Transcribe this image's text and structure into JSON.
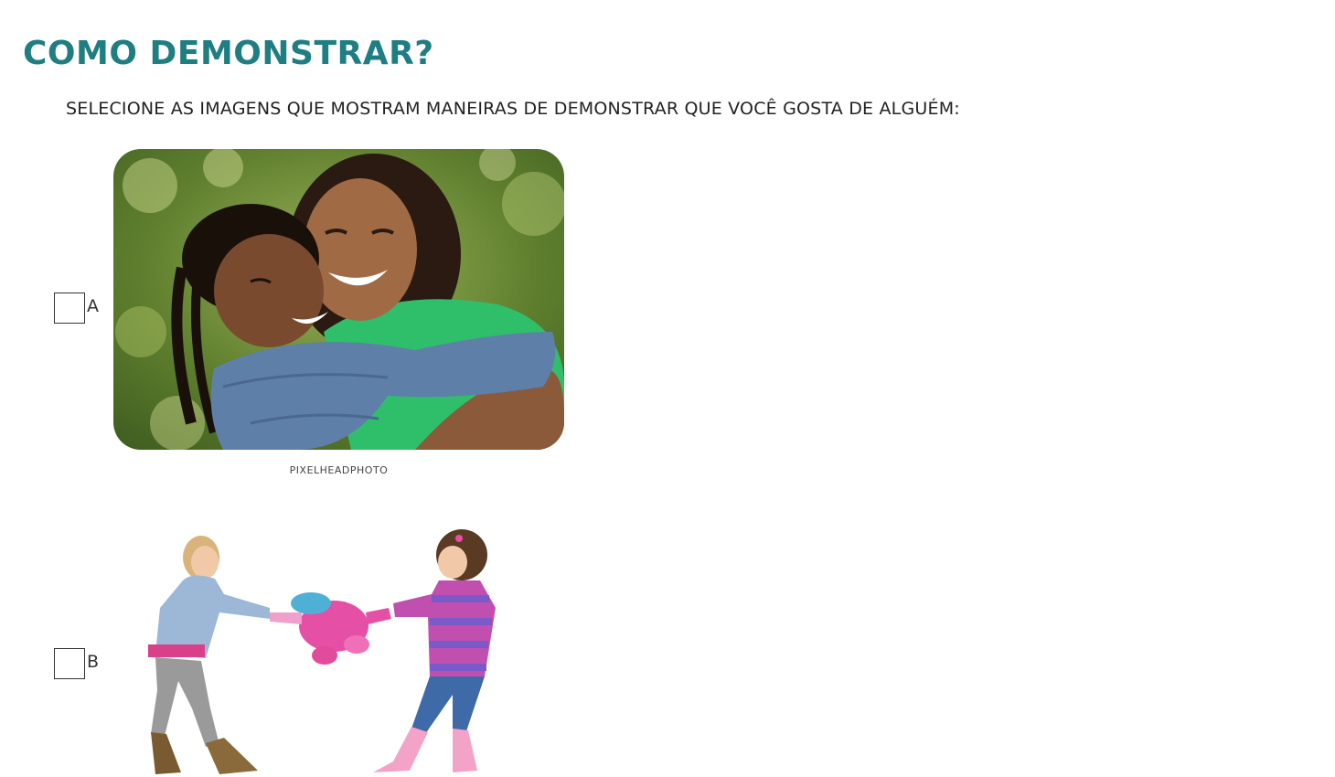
{
  "page": {
    "title": "COMO DEMONSTRAR?",
    "instruction": "SELECIONE AS IMAGENS QUE MOSTRAM MANEIRAS DE DEMONSTRAR QUE VOCÊ GOSTA DE ALGUÉM:"
  },
  "options": [
    {
      "letter": "A",
      "checked": false,
      "image_credit": "PIXELHEADPHOTO"
    },
    {
      "letter": "B",
      "checked": false
    }
  ],
  "colors": {
    "title": "#1e7e82",
    "text": "#222222"
  }
}
